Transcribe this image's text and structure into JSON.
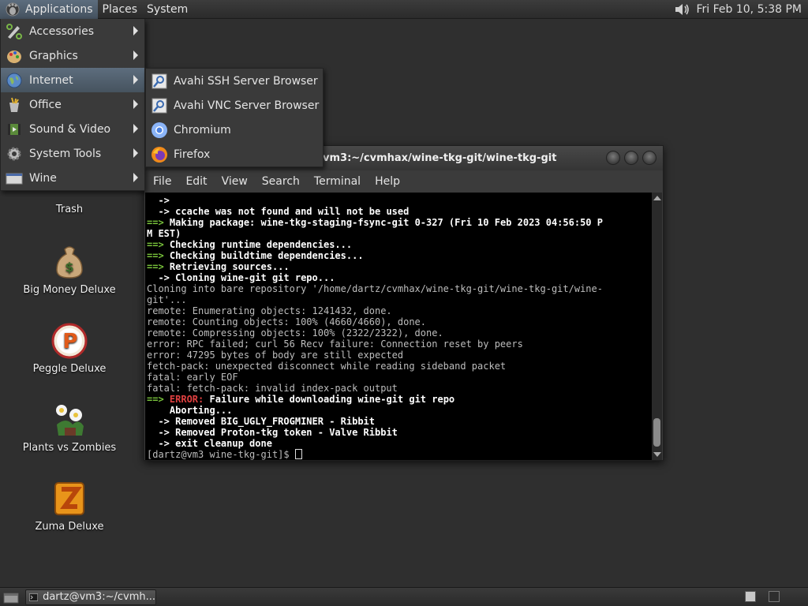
{
  "top_panel": {
    "applications": "Applications",
    "places": "Places",
    "system": "System",
    "datetime": "Fri Feb 10,  5:38 PM"
  },
  "app_menu": {
    "items": [
      {
        "label": "Accessories",
        "icon": "accessories-icon"
      },
      {
        "label": "Graphics",
        "icon": "graphics-icon"
      },
      {
        "label": "Internet",
        "icon": "internet-icon"
      },
      {
        "label": "Office",
        "icon": "office-icon"
      },
      {
        "label": "Sound & Video",
        "icon": "sound-video-icon"
      },
      {
        "label": "System Tools",
        "icon": "system-tools-icon"
      },
      {
        "label": "Wine",
        "icon": "wine-icon"
      }
    ],
    "highlighted": "Internet"
  },
  "internet_submenu": {
    "items": [
      {
        "label": "Avahi SSH Server Browser",
        "icon": "avahi-icon"
      },
      {
        "label": "Avahi VNC Server Browser",
        "icon": "avahi-icon"
      },
      {
        "label": "Chromium",
        "icon": "chromium-icon"
      },
      {
        "label": "Firefox",
        "icon": "firefox-icon"
      }
    ]
  },
  "desktop_icons": [
    {
      "label": "Trash",
      "icon": "trash-icon"
    },
    {
      "label": "Big Money Deluxe",
      "icon": "money-bag-icon"
    },
    {
      "label": "Peggle Deluxe",
      "icon": "peggle-icon"
    },
    {
      "label": "Plants vs Zombies",
      "icon": "plants-icon"
    },
    {
      "label": "Zuma Deluxe",
      "icon": "zuma-icon"
    }
  ],
  "terminal": {
    "title": "vm3:~/cvmhax/wine-tkg-git/wine-tkg-git",
    "menu": [
      "File",
      "Edit",
      "View",
      "Search",
      "Terminal",
      "Help"
    ],
    "lines": [
      {
        "arrow": "  ->",
        "text": ""
      },
      {
        "arrow": "  ->",
        "text": " ccache was not found and will not be used"
      },
      {
        "arrow": "==>",
        "text": " Making package: wine-tkg-staging-fsync-git 0-327 (Fri 10 Feb 2023 04:56:50 P"
      },
      {
        "arrow": "",
        "text": "M EST)"
      },
      {
        "arrow": "==>",
        "text": " Checking runtime dependencies..."
      },
      {
        "arrow": "==>",
        "text": " Checking buildtime dependencies..."
      },
      {
        "arrow": "==>",
        "text": " Retrieving sources..."
      },
      {
        "arrow": "  ->",
        "text": " Cloning wine-git git repo..."
      },
      {
        "plain": "Cloning into bare repository '/home/dartz/cvmhax/wine-tkg-git/wine-tkg-git/wine-"
      },
      {
        "plain": "git'..."
      },
      {
        "plain": "remote: Enumerating objects: 1241432, done."
      },
      {
        "plain": "remote: Counting objects: 100% (4660/4660), done."
      },
      {
        "plain": "remote: Compressing objects: 100% (2322/2322), done."
      },
      {
        "plain": "error: RPC failed; curl 56 Recv failure: Connection reset by peers"
      },
      {
        "plain": "error: 47295 bytes of body are still expected"
      },
      {
        "plain": "fetch-pack: unexpected disconnect while reading sideband packet"
      },
      {
        "plain": "fatal: early EOF"
      },
      {
        "plain": "fatal: fetch-pack: invalid index-pack output"
      },
      {
        "arrow": "==>",
        "error": " ERROR:",
        "text": " Failure while downloading wine-git git repo"
      },
      {
        "arrow": "",
        "text": "    Aborting..."
      },
      {
        "arrow": "  ->",
        "text": " Removed BIG_UGLY_FROGMINER - Ribbit"
      },
      {
        "arrow": "  ->",
        "text": " Removed Proton-tkg token - Valve Ribbit"
      },
      {
        "arrow": "  ->",
        "text": " exit cleanup done"
      }
    ],
    "prompt": "[dartz@vm3 wine-tkg-git]$ "
  },
  "bottom_panel": {
    "task_label": "dartz@vm3:~/cvmh..."
  }
}
